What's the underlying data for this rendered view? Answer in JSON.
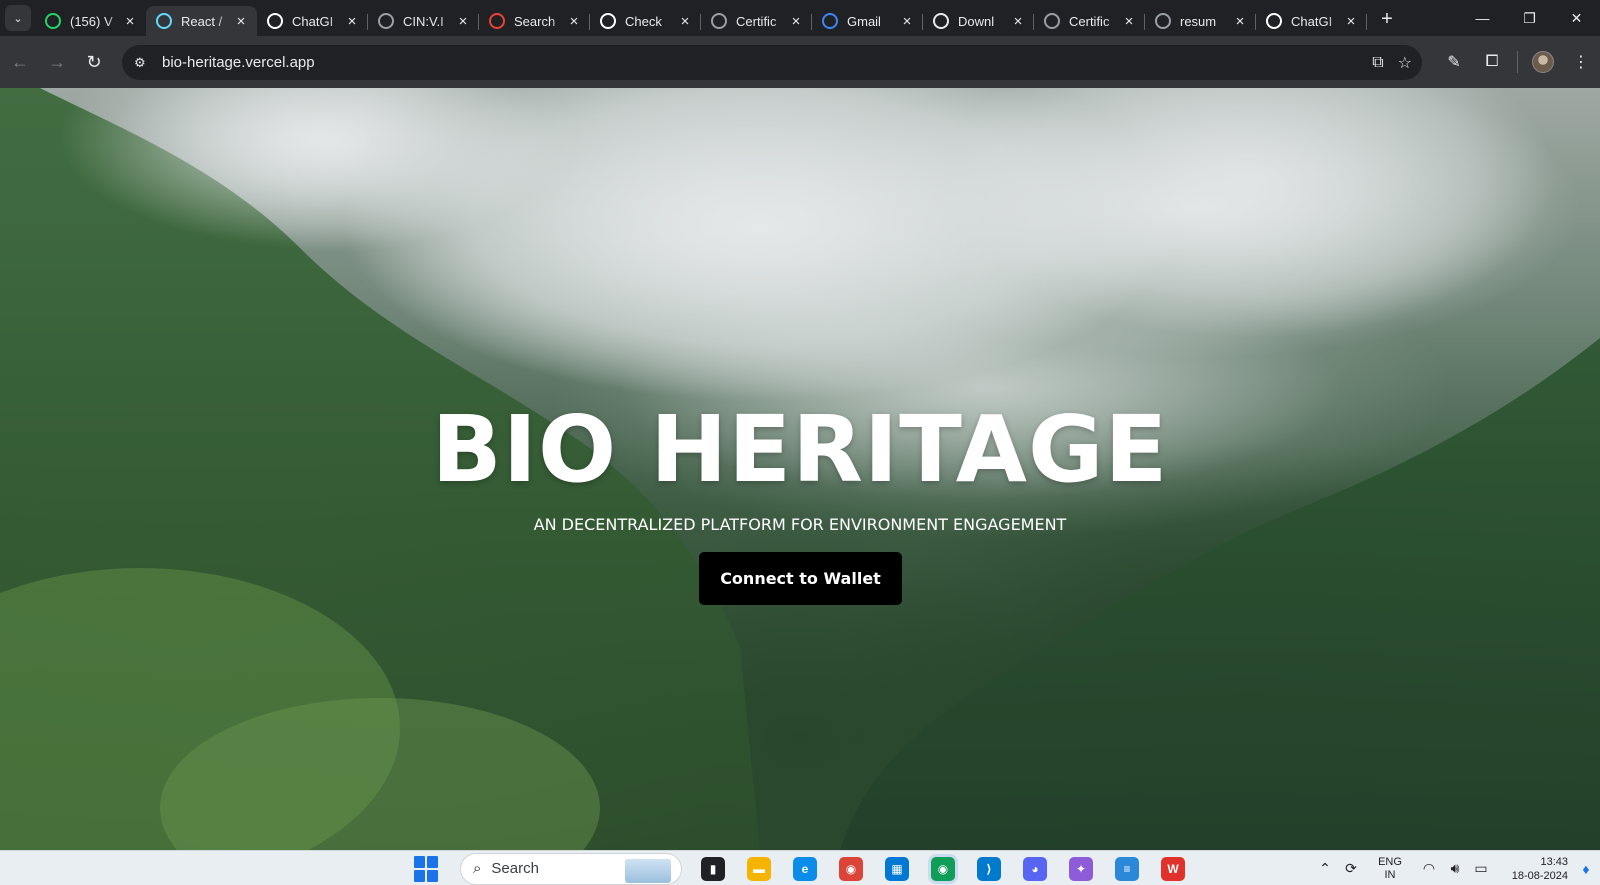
{
  "browser": {
    "tab_search_icon": "chevron-down-icon",
    "tabs": [
      {
        "title": "(156) V",
        "icon": "whatsapp-icon",
        "color": "#25d366",
        "active": false
      },
      {
        "title": "React /",
        "icon": "react-icon",
        "color": "#61dafb",
        "active": true
      },
      {
        "title": "ChatGI",
        "icon": "openai-icon",
        "color": "#ffffff",
        "active": false
      },
      {
        "title": "CIN:V.I",
        "icon": "globe-icon",
        "color": "#9aa0a6",
        "active": false
      },
      {
        "title": "Search",
        "icon": "gmail-icon",
        "color": "#ea4335",
        "active": false
      },
      {
        "title": "Check",
        "icon": "shield-icon",
        "color": "#ffffff",
        "active": false
      },
      {
        "title": "Certific",
        "icon": "globe-icon",
        "color": "#9aa0a6",
        "active": false
      },
      {
        "title": "Gmail",
        "icon": "google-icon",
        "color": "#4285f4",
        "active": false
      },
      {
        "title": "Downl",
        "icon": "download-icon",
        "color": "#e8eaed",
        "active": false
      },
      {
        "title": "Certific",
        "icon": "globe-icon",
        "color": "#9aa0a6",
        "active": false
      },
      {
        "title": "resum",
        "icon": "globe-icon",
        "color": "#9aa0a6",
        "active": false
      },
      {
        "title": "ChatGI",
        "icon": "openai-icon",
        "color": "#ffffff",
        "active": false
      }
    ],
    "new_tab_label": "+",
    "window_controls": {
      "minimize": "—",
      "restore": "❐",
      "close": "✕"
    },
    "toolbar": {
      "back": "←",
      "forward": "→",
      "reload": "↻",
      "url": "bio-heritage.vercel.app",
      "site_info_icon": "tune-icon"
    }
  },
  "page": {
    "title": "BIO HERITAGE",
    "subtitle": "AN DECENTRALIZED PLATFORM FOR ENVIRONMENT ENGAGEMENT",
    "connect_button": "Connect to Wallet"
  },
  "taskbar": {
    "search_label": "Search",
    "apps": [
      {
        "name": "task-view-icon",
        "color": "#202124",
        "glyph": "▮"
      },
      {
        "name": "file-explorer-icon",
        "color": "#f4b400",
        "glyph": "▬"
      },
      {
        "name": "edge-icon",
        "color": "#0c8ce9",
        "glyph": "e"
      },
      {
        "name": "chrome-icon",
        "color": "#db4437",
        "glyph": "◉"
      },
      {
        "name": "microsoft-store-icon",
        "color": "#0078d4",
        "glyph": "▦"
      },
      {
        "name": "chrome-profile-icon",
        "color": "#0f9d58",
        "glyph": "◉"
      },
      {
        "name": "vscode-icon",
        "color": "#007acc",
        "glyph": "⟩"
      },
      {
        "name": "discord-icon",
        "color": "#5865f2",
        "glyph": "◕"
      },
      {
        "name": "copilot-icon",
        "color": "#8e5cd9",
        "glyph": "✦"
      },
      {
        "name": "notepad-icon",
        "color": "#2b88d8",
        "glyph": "≡"
      },
      {
        "name": "wps-office-icon",
        "color": "#e0312a",
        "glyph": "W"
      }
    ],
    "tray": {
      "lang_line1": "ENG",
      "lang_line2": "IN",
      "time": "13:43",
      "date": "18-08-2024"
    }
  }
}
